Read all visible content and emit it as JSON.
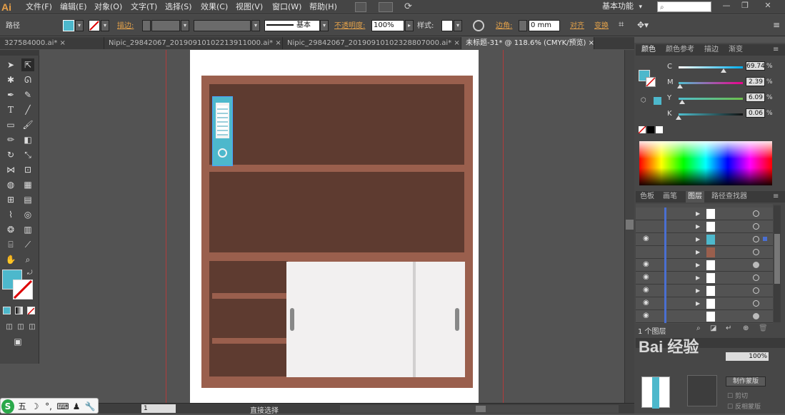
{
  "app": {
    "logo": "Ai"
  },
  "menubar": {
    "items": [
      "文件(F)",
      "编辑(E)",
      "对象(O)",
      "文字(T)",
      "选择(S)",
      "效果(C)",
      "视图(V)",
      "窗口(W)",
      "帮助(H)"
    ],
    "workspace": "基本功能",
    "workspace_chevron": "▾",
    "window_controls": [
      "—",
      "❐",
      "✕"
    ]
  },
  "control_bar": {
    "selection": "路径",
    "stroke_label": "描边:",
    "profile": "基本",
    "opacity_label": "不透明度:",
    "opacity_value": "100%",
    "style_label": "样式:",
    "corner_label": "边角:",
    "corner_value": "0 mm",
    "align": "对齐",
    "transform": "变换"
  },
  "tabs": [
    {
      "label": "327584000.ai*",
      "close": "×"
    },
    {
      "label": "Nipic_29842067_20190910102213911000.ai*",
      "close": "×"
    },
    {
      "label": "Nipic_29842067_20190910102328807000.ai*",
      "close": "×"
    },
    {
      "label": "未标题-31* @ 118.6% (CMYK/预览)",
      "close": "×"
    }
  ],
  "color_panel": {
    "tabs": [
      "颜色",
      "颜色参考",
      "描边",
      "渐变"
    ],
    "channels": [
      {
        "name": "C",
        "value": "69.74",
        "unit": "%",
        "level": 0.6974
      },
      {
        "name": "M",
        "value": "2.39",
        "unit": "%",
        "level": 0.0239
      },
      {
        "name": "Y",
        "value": "6.09",
        "unit": "%",
        "level": 0.0609
      },
      {
        "name": "K",
        "value": "0.06",
        "unit": "%",
        "level": 0.0006
      }
    ]
  },
  "layers_panel": {
    "tabs": [
      "色板",
      "画笔",
      "图层",
      "路径查找器"
    ],
    "footer": "1 个图层"
  },
  "bottom_right": {
    "watermark": "Bai 经验",
    "make_mask": "制作蒙版",
    "clip": "剪切",
    "invert": "反相蒙版"
  },
  "statusbar": {
    "page": "1",
    "tool": "直接选择"
  },
  "ime": {
    "items": [
      "五",
      "☽",
      "°,",
      "⌨",
      "♟",
      "🔧"
    ]
  },
  "colors": {
    "accent": "#4db8cc",
    "wood": "#9a5f4d",
    "dark_wood": "#5e3b30",
    "door": "#f2f0f0"
  }
}
